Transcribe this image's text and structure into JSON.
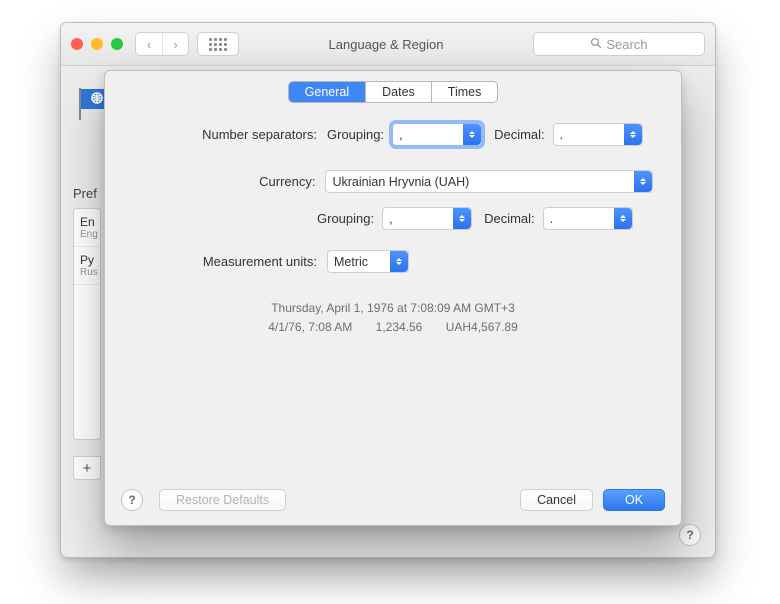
{
  "window": {
    "title": "Language & Region",
    "search_placeholder": "Search"
  },
  "background": {
    "preferred_label": "Pref",
    "languages": [
      {
        "name": "En",
        "sub": "Eng"
      },
      {
        "name": "Py",
        "sub": "Rus"
      }
    ],
    "add_label": "+"
  },
  "sheet": {
    "tabs": {
      "general": "General",
      "dates": "Dates",
      "times": "Times"
    },
    "labels": {
      "number_separators": "Number separators:",
      "grouping": "Grouping:",
      "decimal": "Decimal:",
      "currency": "Currency:",
      "measurement": "Measurement units:"
    },
    "values": {
      "number_grouping": ",",
      "number_decimal": ".",
      "currency_name": "Ukrainian Hryvnia (UAH)",
      "currency_grouping": ",",
      "currency_decimal": ".",
      "measurement": "Metric"
    },
    "preview": {
      "line1": "Thursday, April 1, 1976 at 7:08:09 AM GMT+3",
      "short_date": "4/1/76, 7:08 AM",
      "number": "1,234.56",
      "currency": "UAH4,567.89"
    },
    "buttons": {
      "restore": "Restore Defaults",
      "cancel": "Cancel",
      "ok": "OK"
    },
    "help": "?"
  }
}
